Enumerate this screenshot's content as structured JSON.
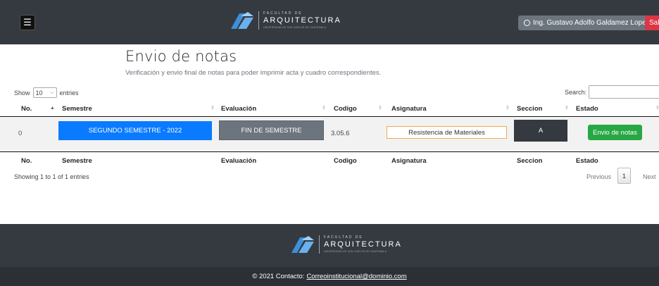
{
  "header": {
    "menu_icon": "hamburger-icon",
    "logo": {
      "line1": "FACULTAD DE",
      "line2": "ARQUITECTURA",
      "line3": "UNIVERSIDAD DE SAN CARLOS DE GUATEMALA"
    },
    "user_label": "Ing. Gustavo Adolfo Galdamez Lopez",
    "user_icon": "user-circle-icon",
    "logout_label": "Salir"
  },
  "page": {
    "title": "Envio de notas",
    "subtitle": "Verificación y envio final de notas para poder imprimir acta y cuadro correspondientes."
  },
  "table_controls": {
    "show_label": "Show",
    "length_value": "10",
    "entries_label": "entries",
    "search_label": "Search:",
    "search_value": ""
  },
  "table": {
    "columns": [
      "No.",
      "Semestre",
      "Evaluación",
      "Codigo",
      "Asignatura",
      "Seccion",
      "Estado"
    ],
    "rows": [
      {
        "no": "0",
        "semestre": "SEGUNDO SEMESTRE - 2022",
        "evaluacion": "FIN DE SEMESTRE",
        "codigo": "3.05.6",
        "asignatura": "Resistencia de Materiales",
        "seccion": "A",
        "estado_button": "Envio de notas"
      }
    ],
    "info": "Showing 1 to 1 of 1 entries",
    "pagination": {
      "previous": "Previous",
      "page": "1",
      "next": "Next"
    }
  },
  "colors": {
    "navbar": "#343a40",
    "primary": "#0a7bff",
    "secondary": "#6c757d",
    "success": "#28a745",
    "danger": "#dc3545",
    "warning_border": "#f0ad4e"
  },
  "footer": {
    "logo": {
      "line1": "FACULTAD DE",
      "line2": "ARQUITECTURA",
      "line3": "UNIVERSIDAD DE SAN CARLOS DE GUATEMALA"
    },
    "contact_prefix": "© 2021 Contacto:",
    "contact_email": "Correoinstitucional@dominio.com"
  }
}
